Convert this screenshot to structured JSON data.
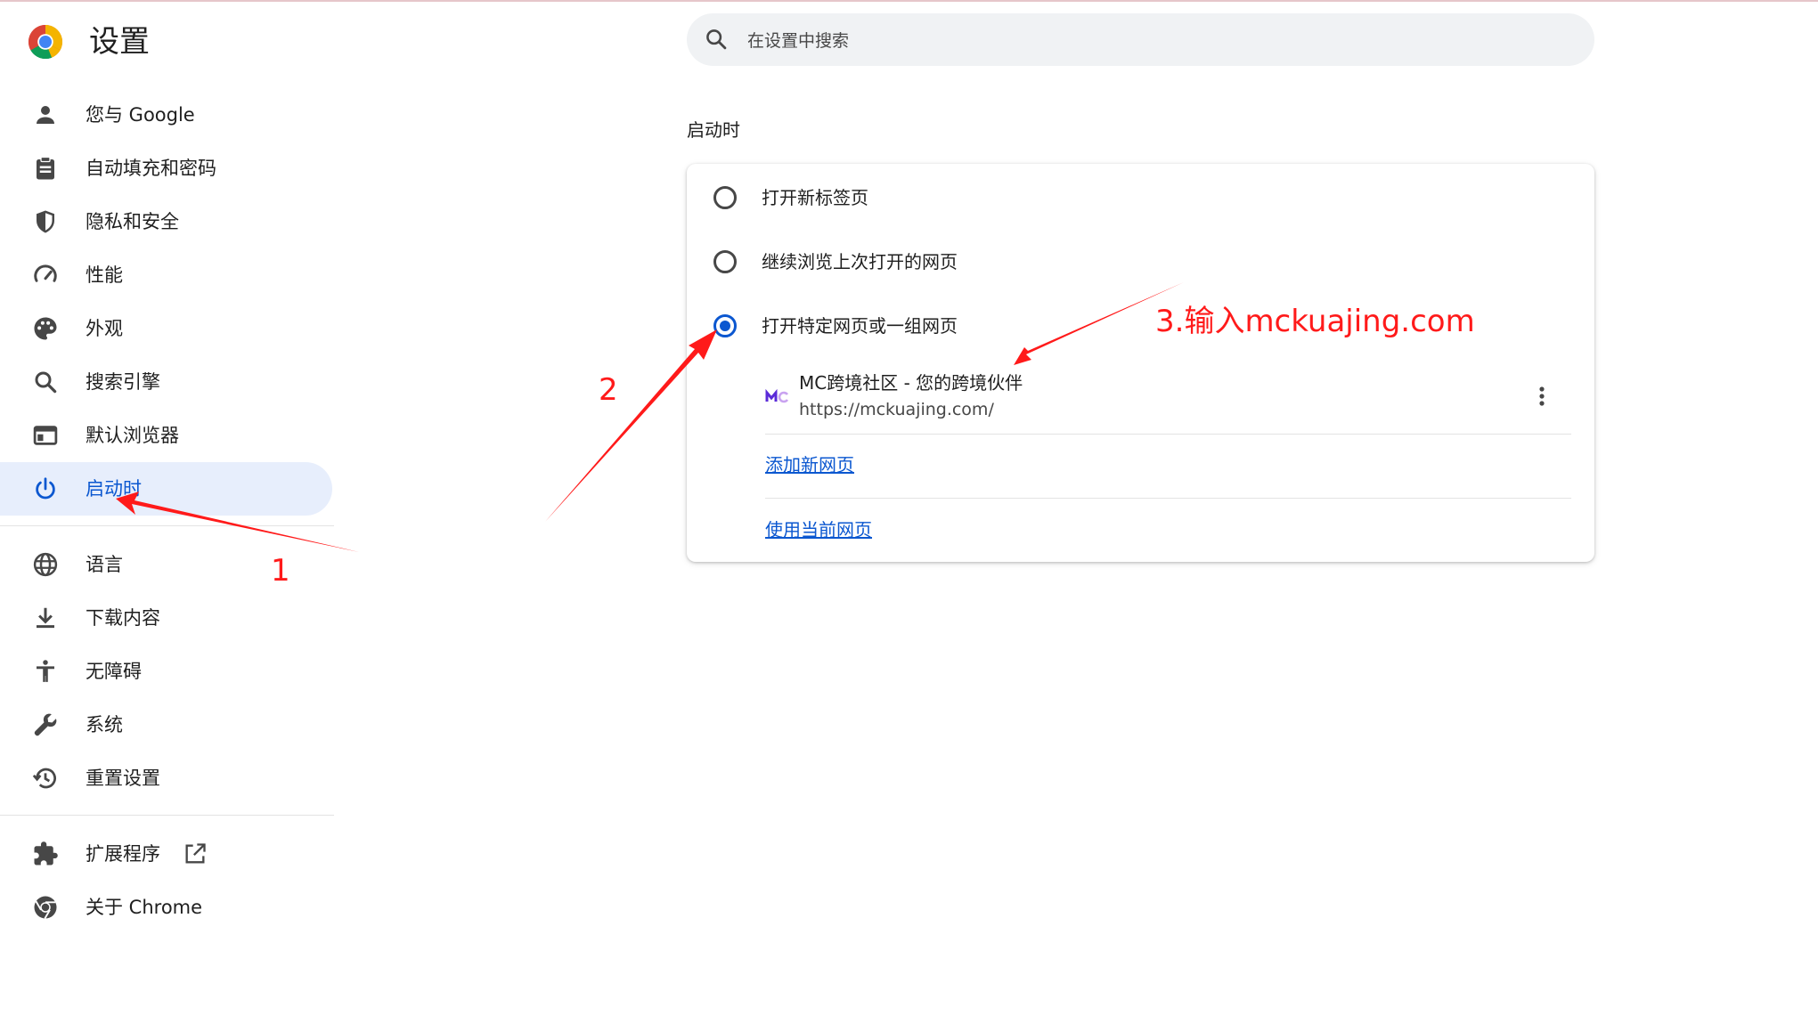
{
  "app": {
    "title": "设置",
    "logo_icon": "chrome-logo-icon"
  },
  "search": {
    "placeholder": "在设置中搜索",
    "icon": "search-icon"
  },
  "sidebar": {
    "items": [
      {
        "label": "您与 Google",
        "icon": "person-icon",
        "active": false
      },
      {
        "label": "自动填充和密码",
        "icon": "clipboard-icon",
        "active": false
      },
      {
        "label": "隐私和安全",
        "icon": "shield-icon",
        "active": false
      },
      {
        "label": "性能",
        "icon": "speedometer-icon",
        "active": false
      },
      {
        "label": "外观",
        "icon": "palette-icon",
        "active": false
      },
      {
        "label": "搜索引擎",
        "icon": "search-icon",
        "active": false
      },
      {
        "label": "默认浏览器",
        "icon": "browser-window-icon",
        "active": false
      },
      {
        "label": "启动时",
        "icon": "power-icon",
        "active": true
      },
      {
        "label": "语言",
        "icon": "globe-icon",
        "active": false
      },
      {
        "label": "下载内容",
        "icon": "download-icon",
        "active": false
      },
      {
        "label": "无障碍",
        "icon": "accessibility-icon",
        "active": false
      },
      {
        "label": "系统",
        "icon": "wrench-icon",
        "active": false
      },
      {
        "label": "重置设置",
        "icon": "history-icon",
        "active": false
      },
      {
        "label": "扩展程序",
        "icon": "puzzle-icon",
        "active": false,
        "external": true
      },
      {
        "label": "关于 Chrome",
        "icon": "chrome-icon",
        "active": false
      }
    ]
  },
  "startup": {
    "title": "启动时",
    "options": [
      {
        "label": "打开新标签页",
        "checked": false
      },
      {
        "label": "继续浏览上次打开的网页",
        "checked": false
      },
      {
        "label": "打开特定网页或一组网页",
        "checked": true
      }
    ],
    "page": {
      "title": "MC跨境社区 - 您的跨境伙伴",
      "url": "https://mckuajing.com/",
      "favicon": "mc-favicon-icon"
    },
    "add_page_label": "添加新网页",
    "use_current_label": "使用当前网页"
  },
  "annotations": {
    "label1": "1",
    "label2": "2",
    "label3": "3.输入mckuajing.com",
    "color": "#ff1a1a"
  },
  "colors": {
    "accent": "#0b57d0",
    "active_bg": "#e7eefc",
    "search_bg": "#f0f2f4"
  }
}
